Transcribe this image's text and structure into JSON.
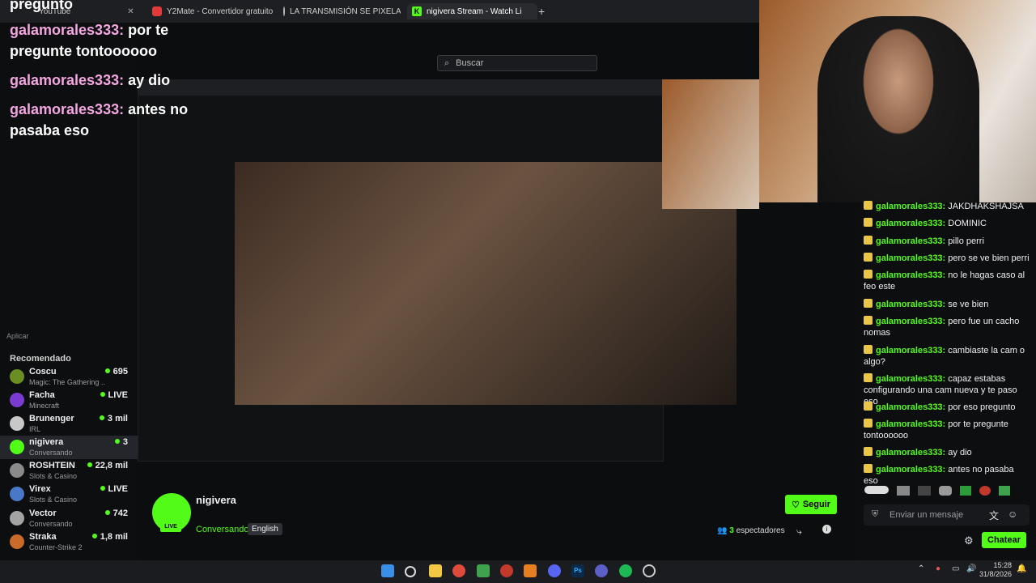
{
  "tabs": [
    {
      "label": "YouTube",
      "x": "close"
    },
    {
      "label": "Y2Mate - Convertidor gratuito"
    },
    {
      "label": "LA TRANSMISIÓN SE PIXELADA"
    },
    {
      "label": "nigivera Stream - Watch Li"
    }
  ],
  "overlay": [
    {
      "user": "galamorales333:",
      "msg": "por te pregunte tontoooooo"
    },
    {
      "user": "galamorales333:",
      "msg": "ay dio"
    },
    {
      "user": "galamorales333:",
      "msg": "antes no pasaba eso"
    }
  ],
  "overlay_top": "pregunto",
  "search_placeholder": "Buscar",
  "sidebar": {
    "recommended_label": "Recomendado",
    "channels": [
      {
        "name": "Coscu",
        "category": "Magic: The Gathering ...",
        "viewers": "695",
        "color": "#6b8e23"
      },
      {
        "name": "Facha",
        "category": "Minecraft",
        "viewers": "LIVE",
        "color": "#7a3bd1"
      },
      {
        "name": "Brunenger",
        "category": "IRL",
        "viewers": "3 mil",
        "color": "#c8c8c8"
      },
      {
        "name": "nigivera",
        "category": "Conversando",
        "viewers": "3",
        "color": "#53fc18"
      },
      {
        "name": "ROSHTEIN",
        "category": "Slots & Casino",
        "viewers": "22,8 mil",
        "color": "#8a8a8a"
      },
      {
        "name": "Virex",
        "category": "Slots & Casino",
        "viewers": "LIVE",
        "color": "#4a78c8"
      },
      {
        "name": "Vector",
        "category": "Conversando",
        "viewers": "742",
        "color": "#a3a3a3"
      },
      {
        "name": "Straka",
        "category": "Counter-Strike 2",
        "viewers": "1,8 mil",
        "color": "#c86a2a"
      }
    ],
    "apply_label": "Aplicar"
  },
  "chat": {
    "messages": [
      {
        "user": "galamorales333:",
        "text": "JAKDHAKSHAJSA"
      },
      {
        "user": "galamorales333:",
        "text": "DOMINIC"
      },
      {
        "user": "galamorales333:",
        "text": "pillo perri"
      },
      {
        "user": "galamorales333:",
        "text": "pero se ve bien perri"
      },
      {
        "user": "galamorales333:",
        "text": "no le hagas caso al feo este"
      },
      {
        "user": "galamorales333:",
        "text": "se ve bien"
      },
      {
        "user": "galamorales333:",
        "text": "pero fue un cacho nomas"
      },
      {
        "user": "galamorales333:",
        "text": "cambiaste la cam o algo?"
      },
      {
        "user": "galamorales333:",
        "text": "capaz estabas configurando una cam nueva y te paso eso"
      },
      {
        "user": "galamorales333:",
        "text": "por eso pregunto"
      },
      {
        "user": "galamorales333:",
        "text": "por te pregunte tontoooooo"
      },
      {
        "user": "galamorales333:",
        "text": "ay dio"
      },
      {
        "user": "galamorales333:",
        "text": "antes no pasaba eso"
      }
    ],
    "input_placeholder": "Enviar un mensaje",
    "send_label": "Chatear"
  },
  "stream": {
    "name": "nigivera",
    "live_label": "LIVE",
    "category": "Conversando",
    "language": "English",
    "follow_label": "Seguir",
    "viewers": "3",
    "viewers_label": "espectadores"
  },
  "clock": {
    "time": "15:28",
    "date": "31/8/2026"
  }
}
